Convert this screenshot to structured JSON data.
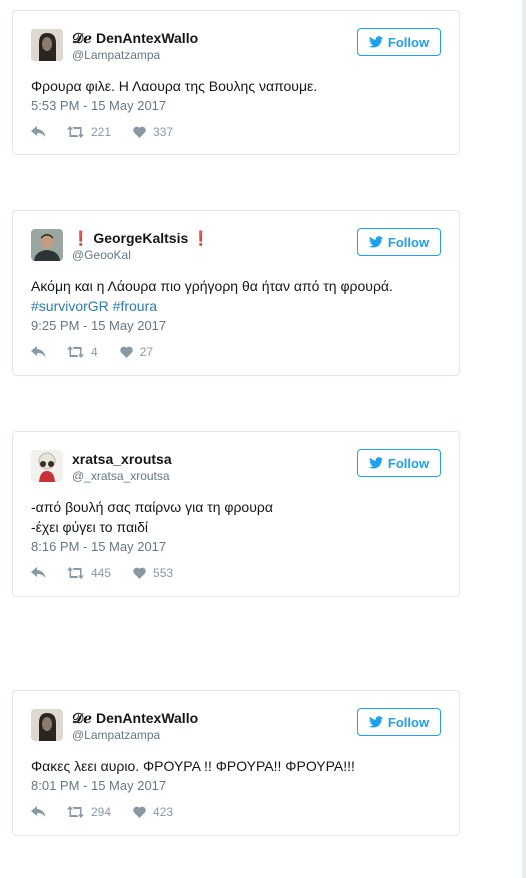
{
  "tweets": [
    {
      "name_prefix": "𝒟ℯ",
      "name": "DenAntexWallo",
      "handle": "@Lampatzampa",
      "text_lines": [
        "Φρουρα φιλε. Η Λαουρα της Βουλης ναπουμε."
      ],
      "time": "5:53 PM - 15 May 2017",
      "retweets": "221",
      "likes": "337",
      "follow_label": "Follow"
    },
    {
      "name_prefix": "❗",
      "name": "GeorgeKaltsis",
      "name_suffix": "❗",
      "handle": "@GeooKal",
      "text_lines": [
        "Ακόμη και η Λάουρα πιο γρήγορη θα ήταν από τη φρουρά."
      ],
      "hashtags": "#survivorGR #froura",
      "time": "9:25 PM - 15 May 2017",
      "retweets": "4",
      "likes": "27",
      "follow_label": "Follow"
    },
    {
      "name": "xratsa_xroutsa",
      "handle": "@_xratsa_xroutsa",
      "text_lines": [
        "-από βουλή σας παίρνω για τη φρουρα",
        "-έχει φύγει το παιδί"
      ],
      "time": "8:16 PM - 15 May 2017",
      "retweets": "445",
      "likes": "553",
      "follow_label": "Follow"
    },
    {
      "name_prefix": "𝒟ℯ",
      "name": "DenAntexWallo",
      "handle": "@Lampatzampa",
      "text_lines": [
        "Φακες λεει αυριο. ΦΡΟΥΡΑ !! ΦΡΟΥΡΑ!! ΦΡΟΥΡΑ!!!"
      ],
      "time": "8:01 PM - 15 May 2017",
      "retweets": "294",
      "likes": "423",
      "follow_label": "Follow"
    }
  ],
  "colors": {
    "accent": "#1da1f2",
    "link": "#2b7bb9",
    "muted": "#657786",
    "border": "#e1e8ed"
  },
  "icons": [
    "twitter-bird-icon",
    "reply-icon",
    "retweet-icon",
    "heart-icon"
  ]
}
